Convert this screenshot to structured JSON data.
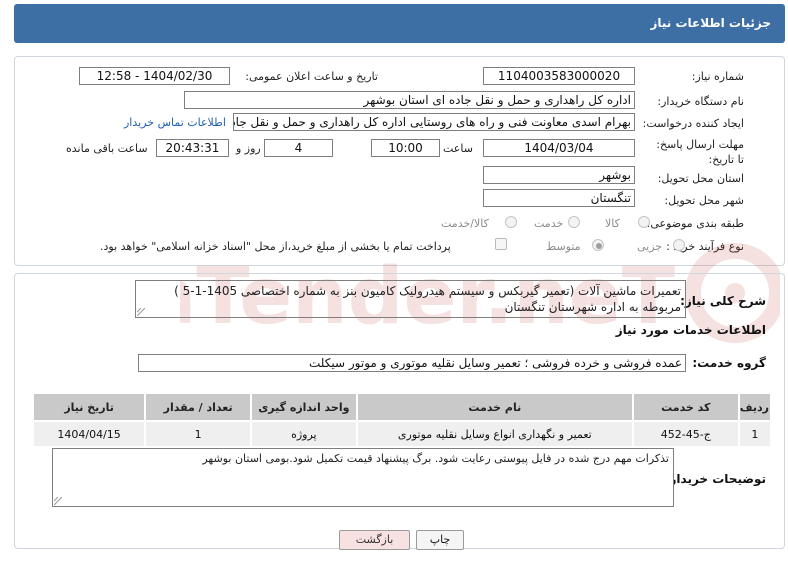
{
  "header": {
    "title": "جزئیات اطلاعات نیاز"
  },
  "form": {
    "need_number_label": "شماره نیاز:",
    "need_number": "1104003583000020",
    "announce_label": "تاریخ و ساعت اعلان عمومی:",
    "announce_value": "1404/02/30 - 12:58",
    "buyer_org_label": "نام دستگاه خریدار:",
    "buyer_org": "اداره کل راهداری و حمل و نقل جاده ای استان بوشهر",
    "creator_label": "ایجاد کننده درخواست:",
    "creator": "بهرام اسدی معاونت فنی و راه های روستایی اداره کل راهداری و حمل و نقل جاده",
    "contact_link": "اطلاعات تماس خریدار",
    "deadline_label": "مهلت ارسال پاسخ: تا تاریخ:",
    "deadline_date": "1404/03/04",
    "time_label": "ساعت",
    "deadline_time": "10:00",
    "days_value": "4",
    "days_label": "روز و",
    "remaining_time": "20:43:31",
    "remaining_label": "ساعت باقی مانده",
    "province_label": "استان محل تحویل:",
    "province": "بوشهر",
    "city_label": "شهر محل تحویل:",
    "city": "تنگستان",
    "category_label": "طبقه بندی موضوعی:",
    "category_options": [
      "کالا",
      "خدمت",
      "کالا/خدمت"
    ],
    "process_label": "نوع فرآیند خرید :",
    "process_options": [
      "جزیی",
      "متوسط"
    ],
    "payment_note": "پرداخت تمام یا بخشی از مبلغ خرید،از محل \"اسناد خزانه اسلامی\" خواهد بود."
  },
  "description": {
    "label": "شرح کلی نیاز:",
    "text": "تعمیرات ماشین آلات (تعمیر گیربکس و سیستم هیدرولیک کامیون بنز به شماره اختصاصی 1405-1-5 ) مربوطه به اداره شهرستان تنگستان"
  },
  "services": {
    "section_title": "اطلاعات خدمات مورد نیاز",
    "group_label": "گروه خدمت:",
    "group_value": "عمده فروشی و خرده فروشی ؛ تعمیر وسایل نقلیه موتوری و موتور سیکلت",
    "table": {
      "headers": [
        "ردیف",
        "کد خدمت",
        "نام خدمت",
        "واحد اندازه گیری",
        "تعداد / مقدار",
        "تاریخ نیاز"
      ],
      "rows": [
        [
          "1",
          "ج-45-452",
          "تعمیر و نگهداری انواع وسایل نقلیه موتوری",
          "پروژه",
          "1",
          "1404/04/15"
        ]
      ]
    }
  },
  "notes": {
    "label": "توضیحات خریدار:",
    "text": "تذکرات مهم درج شده در فایل پیوستی رعایت شود. برگ پیشنهاد قیمت تکمیل شود.بومی استان بوشهر"
  },
  "buttons": {
    "print": "چاپ",
    "back": "بازگشت"
  },
  "watermark": {
    "text": "AriaTender.neT"
  },
  "colors": {
    "header": "#3d6fa5",
    "link": "#1f5fb3",
    "watermark": "#c0392b"
  }
}
